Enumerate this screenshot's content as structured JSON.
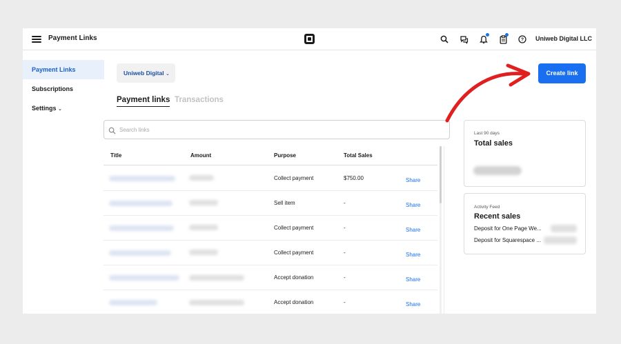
{
  "header": {
    "app_title": "Payment Links",
    "user": "Uniweb Digital LLC",
    "icons": [
      "menu-icon",
      "square-logo-icon",
      "search-icon",
      "chat-icon",
      "bell-icon",
      "clipboard-icon",
      "help-icon"
    ]
  },
  "sidebar": {
    "items": [
      {
        "label": "Payment Links",
        "active": true
      },
      {
        "label": "Subscriptions",
        "active": false
      },
      {
        "label": "Settings",
        "active": false,
        "chevron": "⌄"
      }
    ]
  },
  "business_selector": {
    "label": "Uniweb Digital",
    "chevron": "⌄"
  },
  "create_button": {
    "label": "Create link"
  },
  "tabs": [
    {
      "label": "Payment links",
      "active": true
    },
    {
      "label": "Transactions",
      "active": false
    }
  ],
  "search": {
    "placeholder": "Search links"
  },
  "table": {
    "columns": [
      "Title",
      "Amount",
      "Purpose",
      "Total Sales"
    ],
    "rows": [
      {
        "purpose": "Collect payment",
        "total_sales": "$750.00",
        "action": "Share"
      },
      {
        "purpose": "Sell item",
        "total_sales": "-",
        "action": "Share"
      },
      {
        "purpose": "Collect payment",
        "total_sales": "-",
        "action": "Share"
      },
      {
        "purpose": "Collect payment",
        "total_sales": "-",
        "action": "Share"
      },
      {
        "purpose": "Accept donation",
        "total_sales": "-",
        "action": "Share"
      },
      {
        "purpose": "Accept donation",
        "total_sales": "-",
        "action": "Share"
      }
    ]
  },
  "total_sales_card": {
    "caption": "Last 90 days",
    "title": "Total sales"
  },
  "recent_sales_card": {
    "caption": "Activity Feed",
    "title": "Recent sales",
    "items": [
      "Deposit for One Page We...",
      "Deposit for Squarespace ..."
    ]
  },
  "colors": {
    "accent": "#1a6ff0",
    "annotation_arrow": "#e02020"
  }
}
